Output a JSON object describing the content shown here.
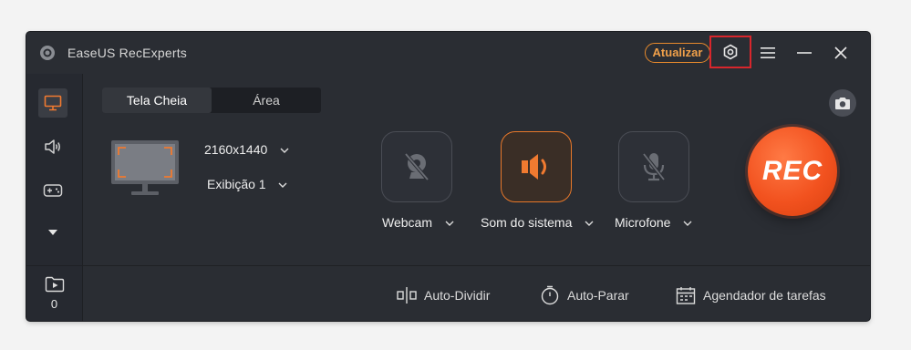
{
  "app": {
    "title": "EaseUS RecExperts",
    "update_label": "Atualizar"
  },
  "tabs": [
    {
      "label": "Tela Cheia",
      "active": true
    },
    {
      "label": "Área",
      "active": false
    }
  ],
  "screen": {
    "resolution": "2160x1440",
    "display": "Exibição 1"
  },
  "sources": [
    {
      "label": "Webcam",
      "icon": "webcam-off-icon",
      "active": false
    },
    {
      "label": "Som do sistema",
      "icon": "speaker-icon",
      "active": true
    },
    {
      "label": "Microfone",
      "icon": "microphone-off-icon",
      "active": false
    }
  ],
  "rec_label": "REC",
  "recordings_count": "0",
  "bottom": {
    "auto_split": "Auto-Dividir",
    "auto_stop": "Auto-Parar",
    "scheduler": "Agendador de tarefas"
  },
  "colors": {
    "accent": "#f2521f",
    "highlight": "#d8262c",
    "update": "#e88a2c",
    "background": "#2a2d33"
  }
}
